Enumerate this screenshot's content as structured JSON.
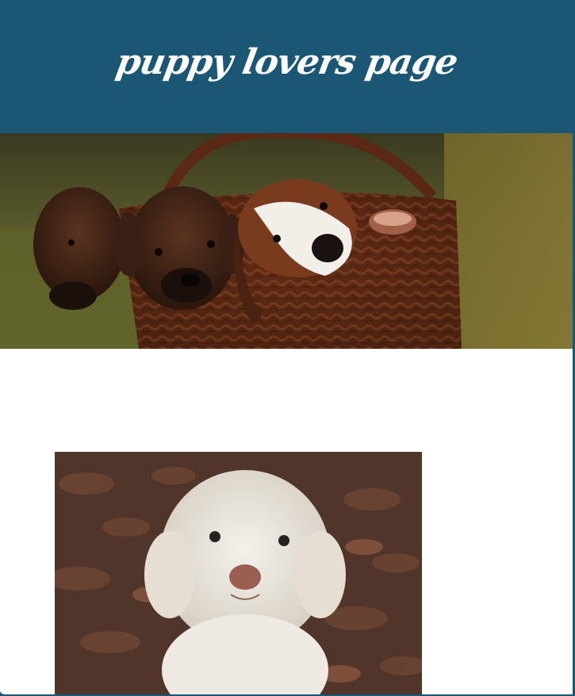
{
  "header": {
    "title": "puppy lovers page",
    "background_color": "#1b5674"
  },
  "images": {
    "hero": "three puppies in a wicker basket photo",
    "second": "white curly puppy photo"
  }
}
